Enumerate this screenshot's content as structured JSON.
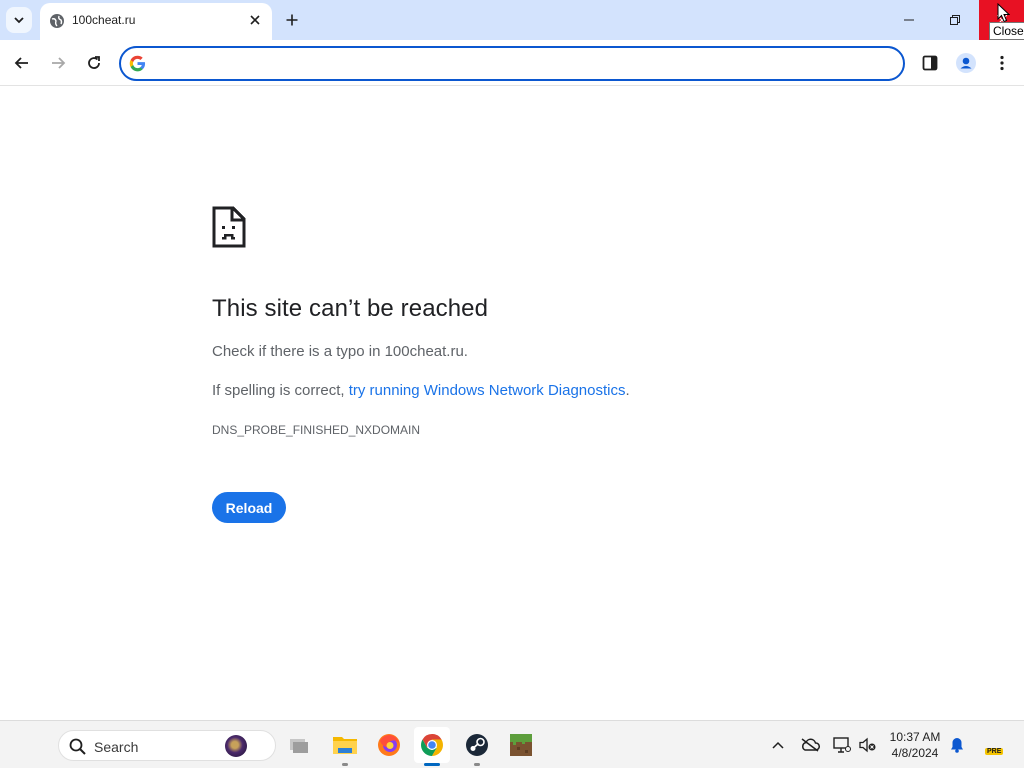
{
  "browser": {
    "tab": {
      "title": "100cheat.ru"
    },
    "omnibox": {
      "value": "",
      "placeholder": ""
    },
    "window_tooltip": "Close",
    "accent": "#0b57d0"
  },
  "error_page": {
    "title": "This site can’t be reached",
    "line1": "Check if there is a typo in 100cheat.ru.",
    "line2_prefix": "If spelling is correct, ",
    "line2_link": "try running Windows Network Diagnostics",
    "line2_suffix": ".",
    "error_code": "DNS_PROBE_FINISHED_NXDOMAIN",
    "reload_label": "Reload",
    "link_color": "#1a73e8"
  },
  "taskbar": {
    "search_label": "Search",
    "apps": [
      "task-view-icon",
      "file-explorer-icon",
      "firefox-icon",
      "chrome-icon",
      "steam-icon",
      "minecraft-icon"
    ],
    "clock": {
      "time": "10:37 AM",
      "date": "4/8/2024"
    },
    "badge": "PRE"
  }
}
